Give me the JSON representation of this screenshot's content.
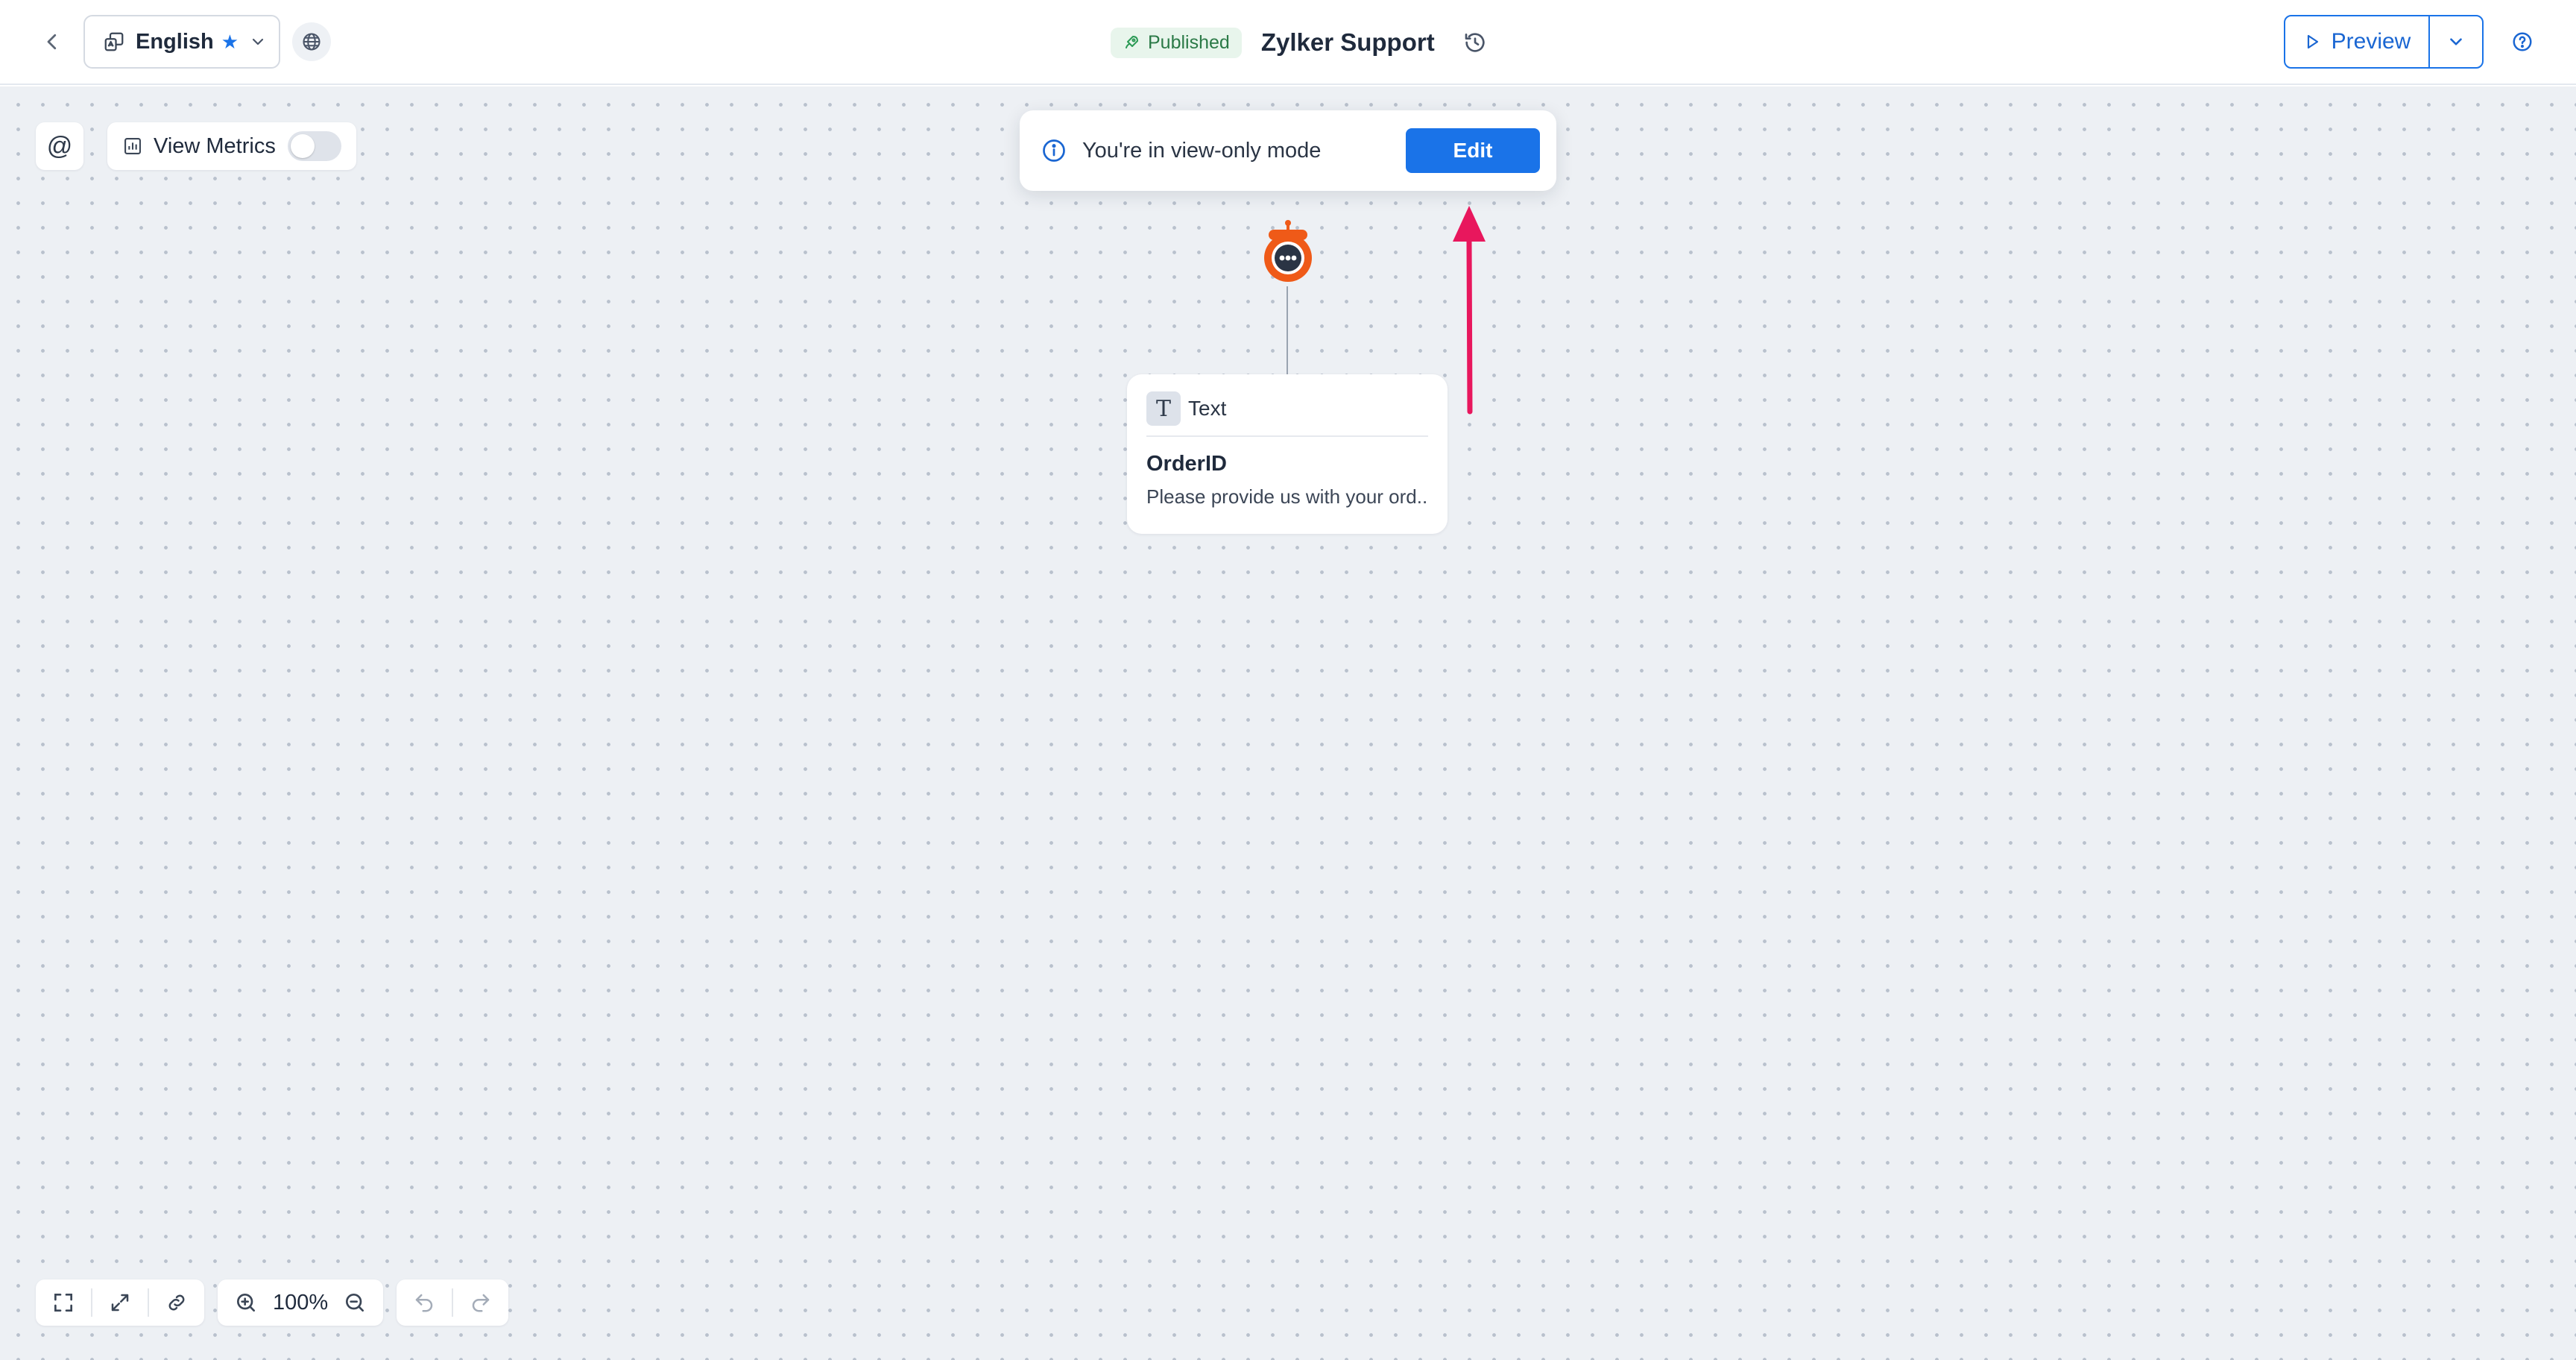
{
  "header": {
    "language_label": "English",
    "published_label": "Published",
    "bot_title": "Zylker Support",
    "preview_label": "Preview"
  },
  "toolbar": {
    "mention_symbol": "@",
    "metrics_label": "View Metrics",
    "metrics_enabled": false
  },
  "banner": {
    "message": "You're in view-only mode",
    "edit_label": "Edit"
  },
  "card": {
    "type_icon": "T",
    "type_label": "Text",
    "title": "OrderID",
    "body": "Please provide us with your ord..."
  },
  "zoom": {
    "level": "100%"
  },
  "colors": {
    "accent": "#1a73e8",
    "published_bg": "#e8f5ec",
    "annotation_arrow": "#e8175d",
    "bot_avatar": "#ef5a18"
  },
  "icons": [
    "back-chevron-icon",
    "languages-icon",
    "star-icon",
    "chevron-down-icon",
    "globe-icon",
    "rocket-icon",
    "history-icon",
    "play-icon",
    "help-icon",
    "metrics-chart-icon",
    "info-icon",
    "bot-icon",
    "fit-screen-icon",
    "expand-icon",
    "link-icon",
    "zoom-in-icon",
    "zoom-out-icon",
    "undo-icon",
    "redo-icon"
  ]
}
